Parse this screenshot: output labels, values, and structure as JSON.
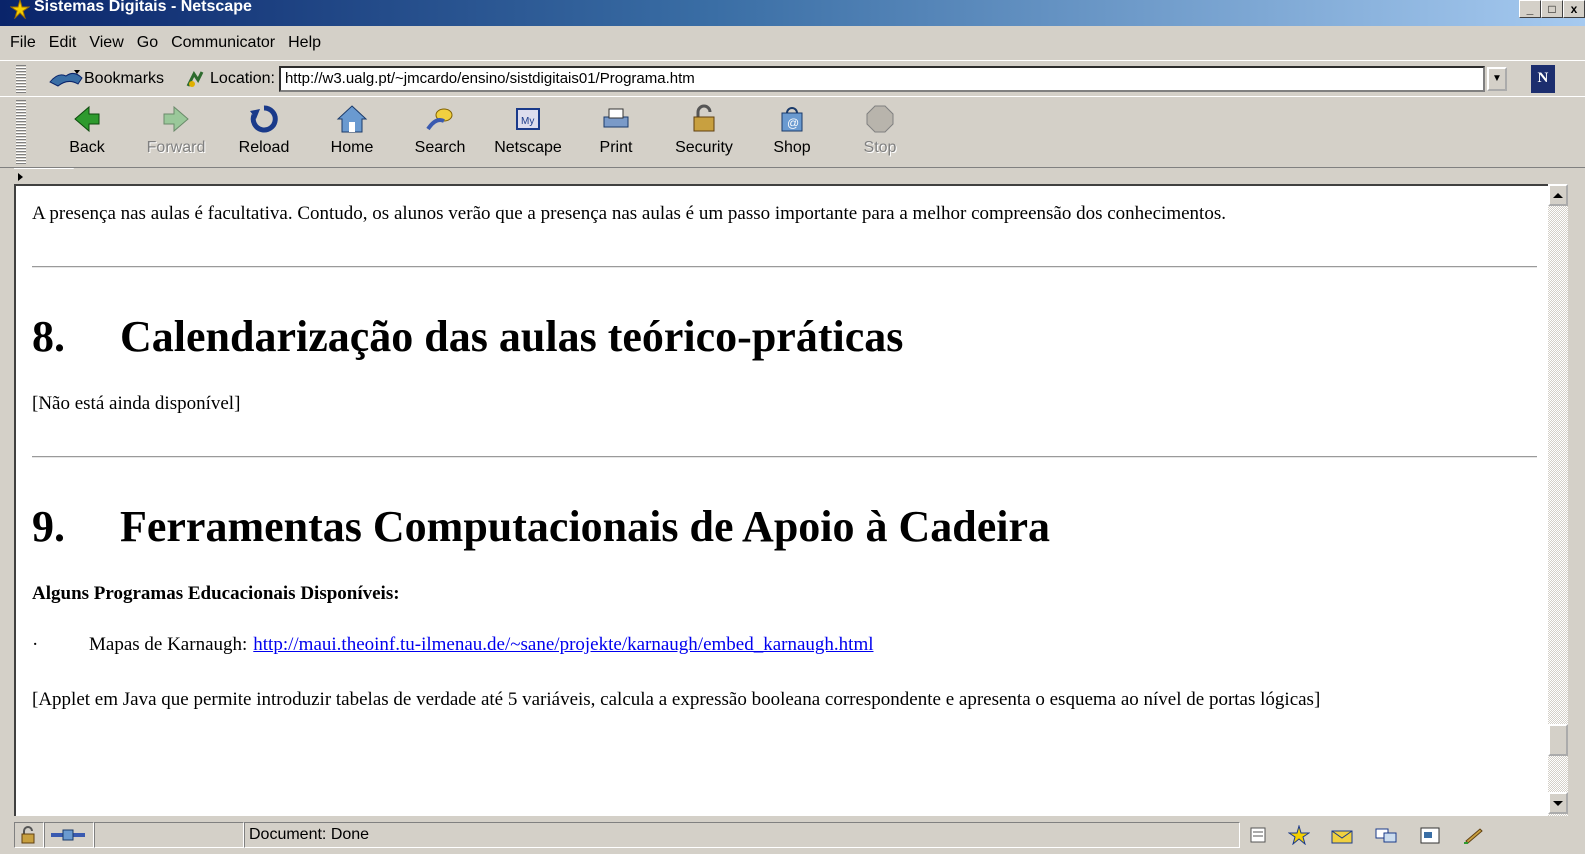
{
  "window": {
    "title": "Sistemas Digitais - Netscape",
    "controls": [
      "_",
      "□",
      "x"
    ]
  },
  "menu": [
    {
      "label": "File"
    },
    {
      "label": "Edit"
    },
    {
      "label": "View"
    },
    {
      "label": "Go"
    },
    {
      "label": "Communicator"
    },
    {
      "label": "Help"
    }
  ],
  "location_bar": {
    "bookmarks_label": "Bookmarks",
    "location_label": "Location:",
    "url": "http://w3.ualg.pt/~jmcardo/ensino/sistdigitais01/Programa.htm",
    "logo_letter": "N"
  },
  "toolbar": [
    {
      "label": "Back",
      "icon": "back-icon",
      "enabled": true
    },
    {
      "label": "Forward",
      "icon": "forward-icon",
      "enabled": false
    },
    {
      "label": "Reload",
      "icon": "reload-icon",
      "enabled": true
    },
    {
      "label": "Home",
      "icon": "home-icon",
      "enabled": true
    },
    {
      "label": "Search",
      "icon": "search-icon",
      "enabled": true
    },
    {
      "label": "Netscape",
      "icon": "my-netscape-icon",
      "enabled": true
    },
    {
      "label": "Print",
      "icon": "print-icon",
      "enabled": true
    },
    {
      "label": "Security",
      "icon": "security-lock-icon",
      "enabled": true
    },
    {
      "label": "Shop",
      "icon": "shop-bag-icon",
      "enabled": true
    },
    {
      "label": "Stop",
      "icon": "stop-icon",
      "enabled": false
    }
  ],
  "content": {
    "intro_paragraph": "A presença nas aulas é facultativa. Contudo, os alunos verão que a presença nas aulas é um passo importante para a melhor compreensão dos conhecimentos.",
    "section8": {
      "number": "8.",
      "title": "Calendarização das aulas teórico-práticas",
      "note": "[Não está ainda disponível]"
    },
    "section9": {
      "number": "9.",
      "title": "Ferramentas Computacionais de Apoio à Cadeira",
      "subheading": "Alguns Programas Educacionais Disponíveis:",
      "bullet_marker": "·",
      "bullet_label": "Mapas de Karnaugh:",
      "bullet_link": "http://maui.theoinf.tu-ilmenau.de/~sane/projekte/karnaugh/embed_karnaugh.html",
      "description": "[Applet em Java que permite introduzir tabelas de verdade até 5 variáveis, calcula a expressão booleana correspondente e apresenta o esquema ao nível de portas lógicas]"
    }
  },
  "status": {
    "text": "Document: Done"
  },
  "colors": {
    "link": "#0000ee",
    "chrome": "#d4d0c8",
    "title_active": "#0a246a"
  }
}
